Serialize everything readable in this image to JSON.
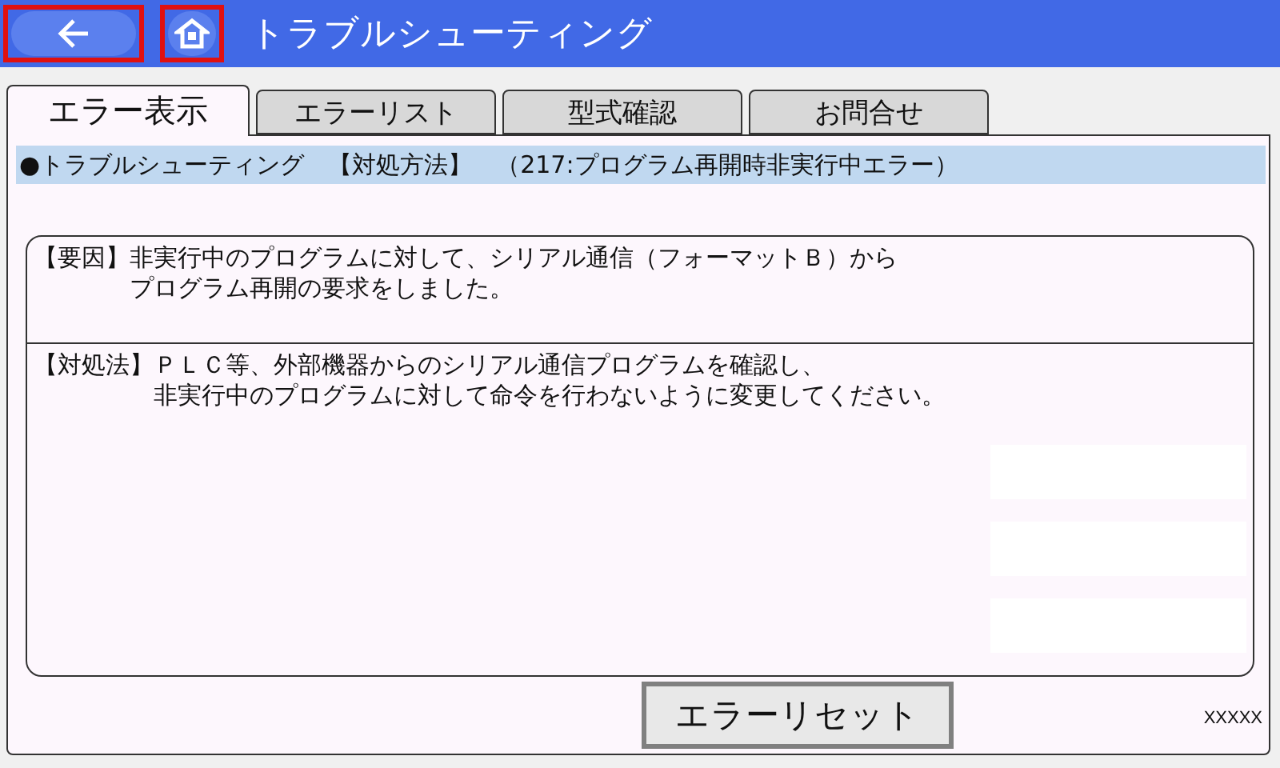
{
  "header": {
    "title": "トラブルシューティング"
  },
  "tabs": [
    {
      "label": "エラー表示",
      "selected": true
    },
    {
      "label": "エラーリスト",
      "selected": false
    },
    {
      "label": "型式確認",
      "selected": false
    },
    {
      "label": "お問合せ",
      "selected": false
    }
  ],
  "section_heading": "●トラブルシューティング　【対処方法】　（217:プログラム再開時非実行中エラー）",
  "cause": {
    "label": "【要因】",
    "lines": [
      "非実行中のプログラムに対して、シリアル通信（フォーマットＢ）から",
      "プログラム再開の要求をしました。"
    ]
  },
  "remedy": {
    "label": "【対処法】",
    "lines": [
      "ＰＬＣ等、外部機器からのシリアル通信プログラムを確認し、",
      "非実行中のプログラムに対して命令を行わないように変更してください。"
    ]
  },
  "reset_button": "エラーリセット",
  "footer_code": "XXXXX"
}
